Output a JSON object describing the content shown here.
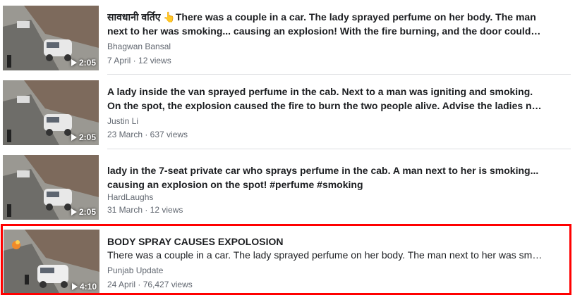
{
  "results": [
    {
      "title": "सावधानी वर्तिए 👆There was a couple in a car. The lady sprayed perfume on her body. The man next to her was smoking... causing an explosion! With the fire burning, and the door couldn't be opened, the two people were burned alive.",
      "description": "",
      "author": "Bhagwan Bansal",
      "meta": "7 April · 12 views",
      "duration": "2:05"
    },
    {
      "title": "A lady inside the van sprayed perfume in the cab. Next to a man was igniting and smoking. On the spot, the explosion caused the fire to burn the two people alive. Advise the ladies not to spray perfume in the car.",
      "description": "",
      "author": "Justin Li",
      "meta": "23 March · 637 views",
      "duration": "2:05"
    },
    {
      "title": "lady in the 7-seat private car who sprays perfume in the cab. A man next to her is smoking... causing an explosion on the spot! #perfume #smoking",
      "description": "",
      "author": "HardLaughs",
      "meta": "31 March · 12 views",
      "duration": "2:05"
    },
    {
      "title": "BODY SPRAY CAUSES EXPOLOSION",
      "description": "There was a couple in a car. The lady sprayed perfume on her body. The man next to her was smoking and caused an explosion.",
      "author": "Punjab Update",
      "meta": "24 April · 76,427 views",
      "duration": "4:10"
    }
  ],
  "colors": {
    "highlight_border": "#ff0000",
    "secondary_text": "#616770",
    "primary_text": "#1c1e21"
  },
  "icons": {
    "play": "play-icon"
  }
}
